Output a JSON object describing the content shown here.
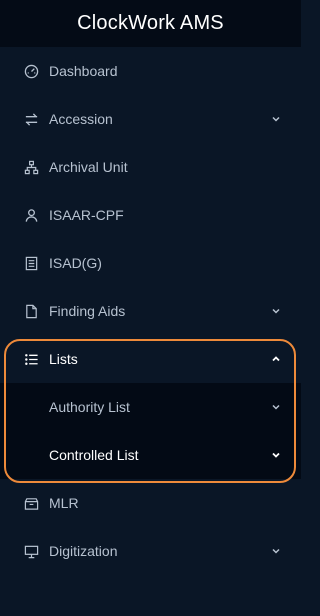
{
  "app": {
    "title": "ClockWork AMS"
  },
  "colors": {
    "sidebar_bg": "#0a1626",
    "header_bg": "#040b16",
    "submenu_bg": "#030a15",
    "highlight": "#ee8a3a",
    "text": "#b7c2d0",
    "text_active": "#ffffff"
  },
  "menu": [
    {
      "label": "Dashboard",
      "icon": "dashboard-icon",
      "chevron": false
    },
    {
      "label": "Accession",
      "icon": "transfer-icon",
      "chevron": "down"
    },
    {
      "label": "Archival Unit",
      "icon": "hierarchy-icon",
      "chevron": false
    },
    {
      "label": "ISAAR-CPF",
      "icon": "person-icon",
      "chevron": false
    },
    {
      "label": "ISAD(G)",
      "icon": "document-list-icon",
      "chevron": false
    },
    {
      "label": "Finding Aids",
      "icon": "file-icon",
      "chevron": "down"
    },
    {
      "label": "Lists",
      "icon": "list-icon",
      "chevron": "up",
      "expanded": true,
      "children": [
        {
          "label": "Authority List",
          "chevron": "down"
        },
        {
          "label": "Controlled List",
          "chevron": "down"
        }
      ]
    },
    {
      "label": "MLR",
      "icon": "archive-box-icon",
      "chevron": false
    },
    {
      "label": "Digitization",
      "icon": "monitor-icon",
      "chevron": "down"
    }
  ]
}
